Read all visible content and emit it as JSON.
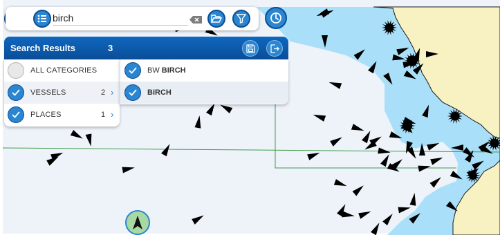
{
  "search": {
    "value": "birch"
  },
  "results": {
    "title": "Search Results",
    "count": "3",
    "categories": [
      {
        "label": "ALL CATEGORIES",
        "count": "",
        "checked": false
      },
      {
        "label": "VESSELS",
        "count": "2",
        "checked": true
      },
      {
        "label": "PLACES",
        "count": "1",
        "checked": true
      }
    ],
    "items": [
      {
        "prefix": "BW ",
        "match": "BIRCH",
        "checked": true
      },
      {
        "prefix": "",
        "match": "BIRCH",
        "checked": true
      }
    ]
  },
  "icons": {
    "search": "search-icon",
    "list": "list-icon",
    "clear": "backspace-icon",
    "folder": "folder-open-icon",
    "filter": "filter-icon",
    "clock": "clock-icon",
    "save": "save-icon",
    "exit": "exit-icon",
    "check": "check-icon",
    "chevron": "chevron-right-icon",
    "compass": "north-arrow-icon"
  },
  "colors": {
    "sea_deep": "#eef3fa",
    "sea_shallow": "#aadff9",
    "land": "#f8f1c2",
    "boundary_line": "#3f9a4a",
    "vessel": "#000000",
    "accent": "#2a86d1",
    "header": "#0b56a4"
  }
}
